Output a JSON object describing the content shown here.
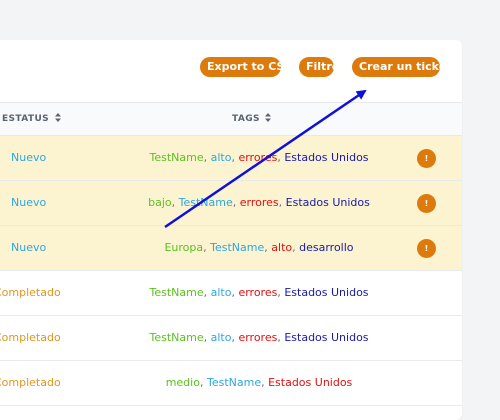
{
  "colors": {
    "accent": "#dd7a0c",
    "row_highlight": "#fcf3d0",
    "status_new": "#2ea7dc",
    "status_completed": "#e0961f",
    "annotation_arrow": "#1010d8"
  },
  "toolbar": {
    "export_label": "Export to CSV",
    "filter_label": "Filtro",
    "create_label": "Crear un ticket"
  },
  "table": {
    "headers": {
      "status": "ESTATUS",
      "tags": "TAGS"
    },
    "rows": [
      {
        "status": "Nuevo",
        "status_kind": "new",
        "highlighted": true,
        "has_alert": true,
        "tags": [
          {
            "text": "TestName",
            "color": "#5cc120"
          },
          {
            "text": "alto",
            "color": "#2ea7dc"
          },
          {
            "text": "errores",
            "color": "#e01010"
          },
          {
            "text": "Estados Unidos",
            "color": "#1a1aa6"
          }
        ]
      },
      {
        "status": "Nuevo",
        "status_kind": "new",
        "highlighted": true,
        "has_alert": true,
        "tags": [
          {
            "text": "bajo",
            "color": "#5cc120"
          },
          {
            "text": "TestName",
            "color": "#2ea7dc"
          },
          {
            "text": "errores",
            "color": "#e01010"
          },
          {
            "text": "Estados Unidos",
            "color": "#1a1aa6"
          }
        ]
      },
      {
        "status": "Nuevo",
        "status_kind": "new",
        "highlighted": true,
        "has_alert": true,
        "tags": [
          {
            "text": "Europa",
            "color": "#5cc120"
          },
          {
            "text": "TestName",
            "color": "#2ea7dc"
          },
          {
            "text": "alto",
            "color": "#e01010"
          },
          {
            "text": "desarrollo",
            "color": "#1a1aa6"
          }
        ]
      },
      {
        "status": "Completado",
        "status_kind": "done",
        "highlighted": false,
        "has_alert": false,
        "tags": [
          {
            "text": "TestName",
            "color": "#5cc120"
          },
          {
            "text": "alto",
            "color": "#2ea7dc"
          },
          {
            "text": "errores",
            "color": "#e01010"
          },
          {
            "text": "Estados Unidos",
            "color": "#1a1aa6"
          }
        ]
      },
      {
        "status": "Completado",
        "status_kind": "done",
        "highlighted": false,
        "has_alert": false,
        "tags": [
          {
            "text": "TestName",
            "color": "#5cc120"
          },
          {
            "text": "alto",
            "color": "#2ea7dc"
          },
          {
            "text": "errores",
            "color": "#e01010"
          },
          {
            "text": "Estados Unidos",
            "color": "#1a1aa6"
          }
        ]
      },
      {
        "status": "Completado",
        "status_kind": "done",
        "highlighted": false,
        "has_alert": false,
        "tags": [
          {
            "text": "medio",
            "color": "#5cc120"
          },
          {
            "text": "TestName",
            "color": "#2ea7dc"
          },
          {
            "text": "Estados Unidos",
            "color": "#e01010"
          }
        ]
      }
    ]
  },
  "icons": {
    "sort": "sort-arrows-icon",
    "alert": "alert-icon",
    "alert_glyph": "!"
  }
}
